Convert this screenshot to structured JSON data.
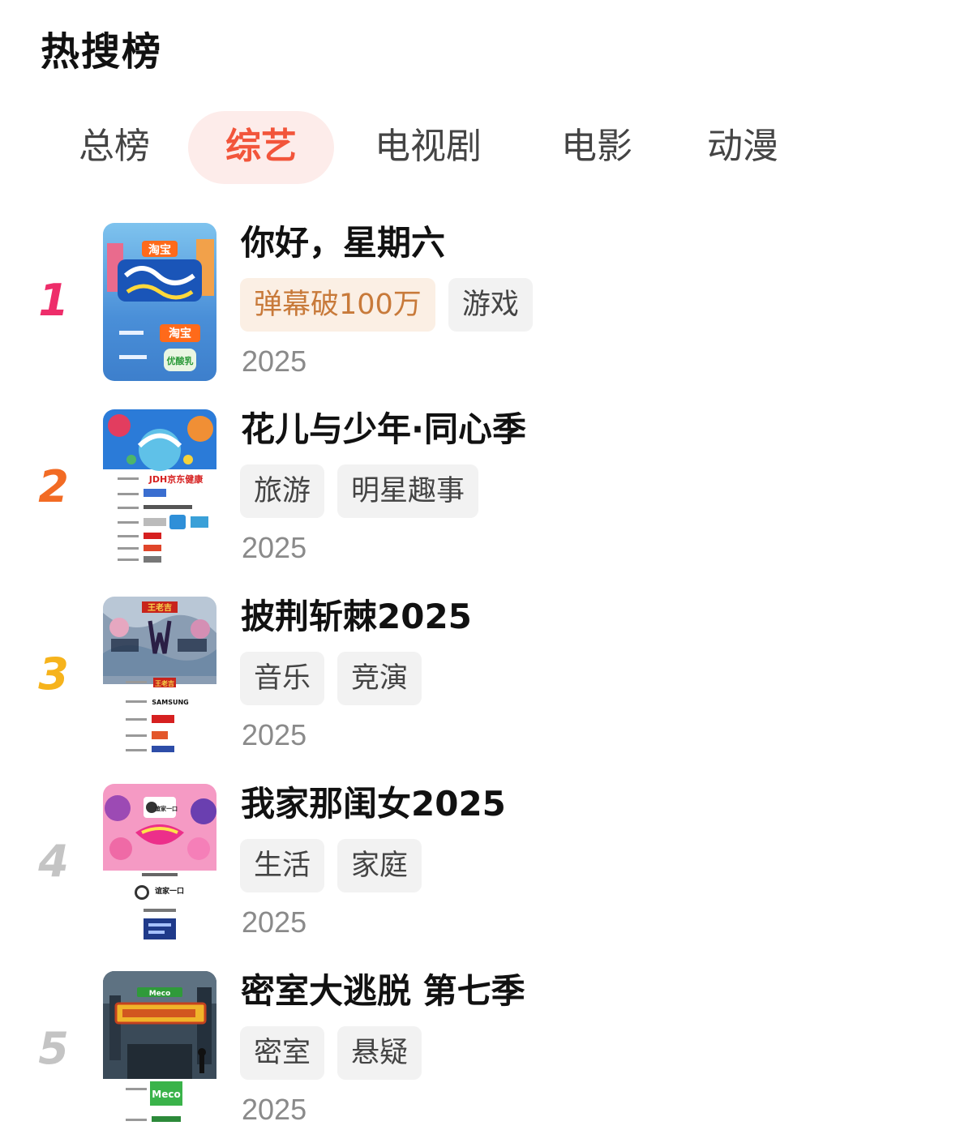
{
  "header": {
    "title": "热搜榜"
  },
  "tabs": [
    {
      "label": "总榜",
      "active": false
    },
    {
      "label": "综艺",
      "active": true
    },
    {
      "label": "电视剧",
      "active": false
    },
    {
      "label": "电影",
      "active": false
    },
    {
      "label": "动漫",
      "active": false
    }
  ],
  "colors": {
    "accent": "#f2553b",
    "accent_bg": "#fdecea",
    "rank_1": "#ee2d6a",
    "rank_2": "#f26b24",
    "rank_3": "#f6b31c",
    "rank_other": "#c4c4c4",
    "hot_tag_bg": "#fbefe4",
    "hot_tag_text": "#c87a3a"
  },
  "items": [
    {
      "rank": "1",
      "title": "你好，星期六",
      "tags": [
        "弹幕破100万",
        "游戏"
      ],
      "year": "2025",
      "poster_brand": "淘宝",
      "poster_sponsor": "优酸乳"
    },
    {
      "rank": "2",
      "title": "花儿与少年·同心季",
      "tags": [
        "旅游",
        "明星趣事"
      ],
      "year": "2025",
      "poster_brand": "JDH京东健康"
    },
    {
      "rank": "3",
      "title": "披荆斩棘2025",
      "tags": [
        "音乐",
        "竞演"
      ],
      "year": "2025",
      "poster_brand": "王老吉",
      "poster_sponsor": "SAMSUNG"
    },
    {
      "rank": "4",
      "title": "我家那闺女2025",
      "tags": [
        "生活",
        "家庭"
      ],
      "year": "2025",
      "poster_brand": "谊家一口"
    },
    {
      "rank": "5",
      "title": "密室大逃脱 第七季",
      "tags": [
        "密室",
        "悬疑"
      ],
      "year": "2025",
      "poster_brand": "Meco"
    }
  ]
}
